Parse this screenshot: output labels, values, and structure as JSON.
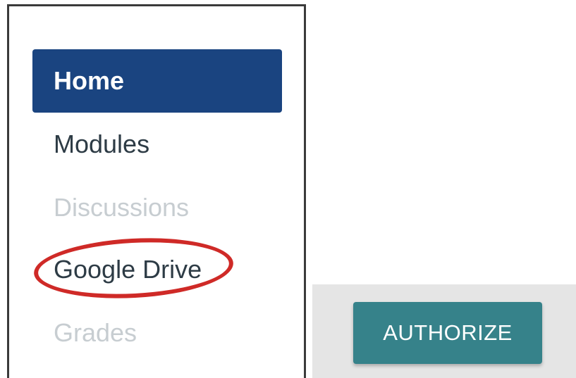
{
  "course_nav": {
    "items": [
      {
        "label": "Home",
        "state": "active"
      },
      {
        "label": "Modules",
        "state": "normal"
      },
      {
        "label": "Discussions",
        "state": "disabled"
      },
      {
        "label": "Google Drive",
        "state": "normal",
        "highlighted": true
      },
      {
        "label": "Grades",
        "state": "disabled"
      }
    ]
  },
  "authorize_panel": {
    "button_label": "AUTHORIZE"
  },
  "colors": {
    "active_bg": "#1a4480",
    "highlight_ellipse": "#cf2a27",
    "authorize_button": "#36828a",
    "panel_bg": "#e5e5e5"
  }
}
